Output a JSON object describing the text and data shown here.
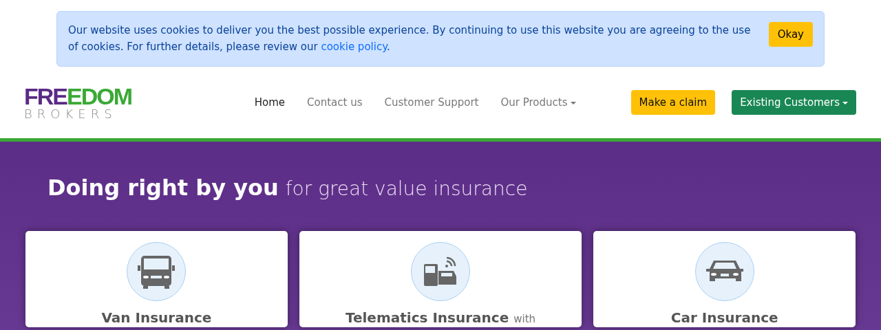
{
  "cookie_banner": {
    "text": "Our website uses cookies to deliver you the best possible experience. By continuing to use this website you are agreeing to the use of cookies. For further details, please review our",
    "link": "cookie policy",
    "after_link": ".",
    "button": "Okay"
  },
  "logo": {
    "part_1": "FRE",
    "part_2": "EDOM",
    "subtitle": "BROKERS"
  },
  "nav": [
    {
      "label": "Home",
      "selected": true,
      "dropdown": false
    },
    {
      "label": "Contact us",
      "selected": false,
      "dropdown": false
    },
    {
      "label": "Customer Support",
      "selected": false,
      "dropdown": false
    },
    {
      "label": "Our Products",
      "selected": false,
      "dropdown": true
    }
  ],
  "actions": [
    {
      "label": "Make a claim",
      "kind": "claim",
      "dropdown": false
    },
    {
      "label": "Existing Customers",
      "kind": "customers",
      "dropdown": true
    }
  ],
  "hero": {
    "title": "Doing right by you",
    "subtitle": "for great value insurance"
  },
  "cards": [
    {
      "kind": "van",
      "title": "Van Insurance"
    },
    {
      "kind": "telematics",
      "title": "Telematics Insurance",
      "suffix": "with"
    },
    {
      "kind": "car",
      "title": "Car Insurance"
    }
  ]
}
